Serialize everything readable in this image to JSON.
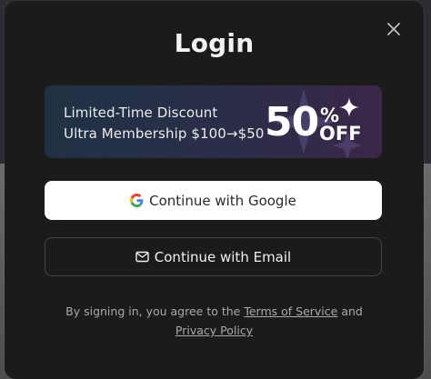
{
  "modal": {
    "title": "Login",
    "close_icon": "close-icon"
  },
  "promo": {
    "line1": "Limited-Time Discount",
    "line2": "Ultra Membership $100→$50",
    "big_number": "50",
    "percent_sign": "%",
    "off_text": "OFF",
    "sparkle_icon": "sparkle-icon"
  },
  "buttons": {
    "google_label": "Continue with Google",
    "google_icon": "google-icon",
    "email_label": "Continue with Email",
    "email_icon": "mail-icon"
  },
  "legal": {
    "prefix": "By signing in, you agree to the ",
    "terms_link": "Terms of Service",
    "and_text": " and",
    "privacy_link": "Privacy Policy"
  },
  "colors": {
    "modal_bg": "#1b1b1b",
    "promo_start": "#1f3244",
    "promo_end": "#3b2747",
    "google_blue": "#4285F4",
    "google_red": "#EA4335",
    "google_yellow": "#FBBC05",
    "google_green": "#34A853"
  }
}
